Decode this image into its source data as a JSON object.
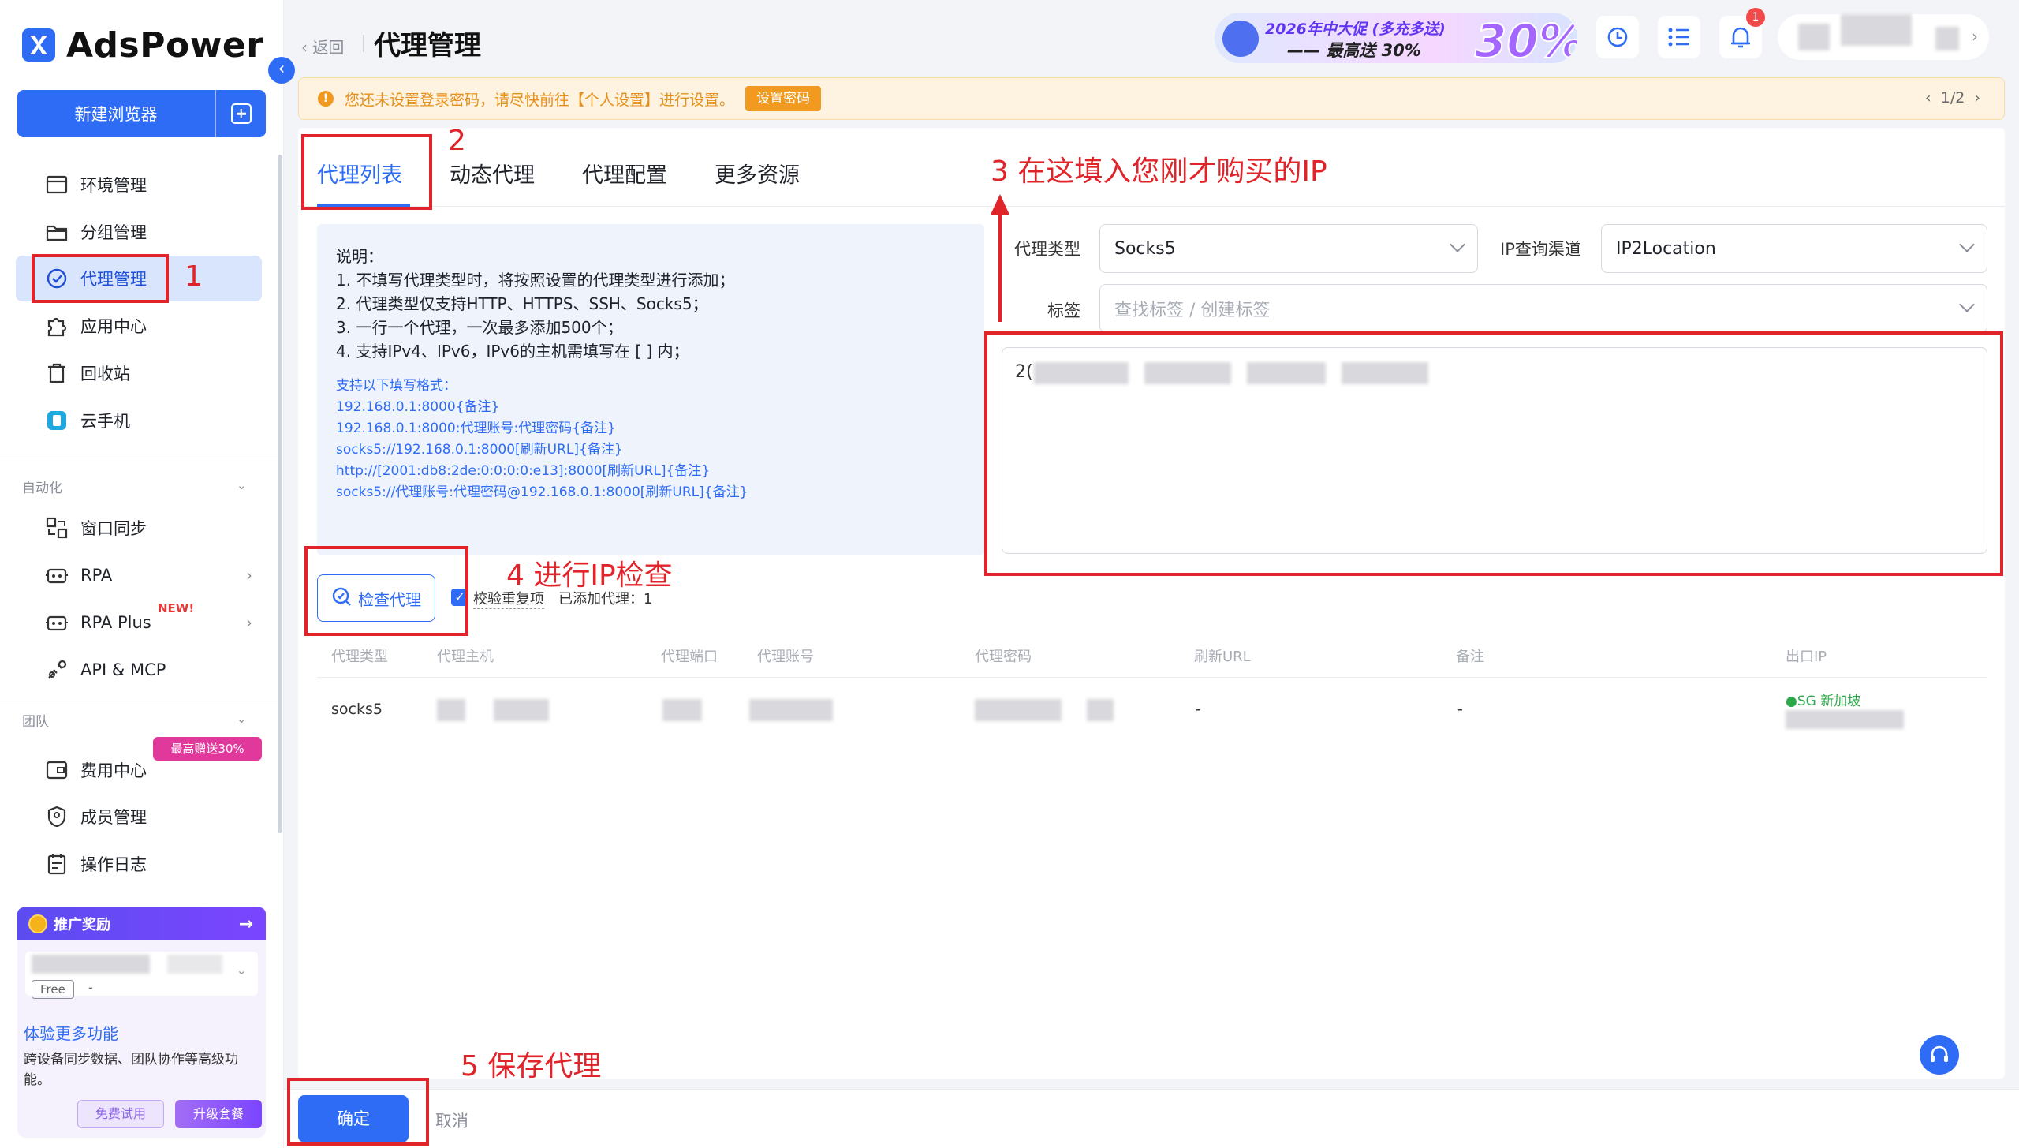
{
  "app": {
    "name": "AdsPower"
  },
  "sidebar": {
    "new_browser_label": "新建浏览器",
    "items": [
      {
        "label": "环境管理",
        "icon": "browser-window-icon"
      },
      {
        "label": "分组管理",
        "icon": "folder-icon"
      },
      {
        "label": "代理管理",
        "icon": "proxy-icon",
        "active": true
      },
      {
        "label": "应用中心",
        "icon": "puzzle-icon"
      },
      {
        "label": "回收站",
        "icon": "trash-icon"
      },
      {
        "label": "云手机",
        "icon": "cloud-phone-icon"
      }
    ],
    "section_automation": "自动化",
    "automation_items": [
      {
        "label": "窗口同步",
        "icon": "window-sync-icon"
      },
      {
        "label": "RPA",
        "icon": "robot-icon"
      },
      {
        "label": "RPA Plus",
        "icon": "robot-icon",
        "badge": "NEW!"
      },
      {
        "label": "API & MCP",
        "icon": "api-icon"
      }
    ],
    "section_team": "团队",
    "team_badge": "最高赠送30%",
    "team_items": [
      {
        "label": "费用中心",
        "icon": "wallet-icon"
      },
      {
        "label": "成员管理",
        "icon": "shield-user-icon"
      },
      {
        "label": "操作日志",
        "icon": "log-icon"
      }
    ],
    "promo": {
      "header": "推广奖励",
      "plan": "Free",
      "plan_suffix": "-",
      "title": "体验更多功能",
      "desc": "跨设备同步数据、团队协作等高级功能。",
      "trial_label": "免费试用",
      "upgrade_label": "升级套餐"
    }
  },
  "header": {
    "back_label": "返回",
    "title": "代理管理",
    "banner": {
      "line1": "2026年中大促 (多充多送)",
      "line2": "—— 最高送 30%",
      "big": "30%"
    },
    "notif_count": "1"
  },
  "alert": {
    "text": "您还未设置登录密码，请尽快前往【个人设置】进行设置。",
    "button": "设置密码",
    "pager": "1/2"
  },
  "tabs": [
    "代理列表",
    "动态代理",
    "代理配置",
    "更多资源"
  ],
  "info": {
    "lines": [
      "说明：",
      "1. 不填写代理类型时，将按照设置的代理类型进行添加；",
      "2. 代理类型仅支持HTTP、HTTPS、SSH、Socks5；",
      "3. 一行一个代理，一次最多添加500个；",
      "4. 支持IPv4、IPv6，IPv6的主机需填写在 [ ] 内；"
    ],
    "formats_title": "支持以下填写格式：",
    "formats": [
      "192.168.0.1:8000{备注}",
      "192.168.0.1:8000:代理账号:代理密码{备注}",
      "socks5://192.168.0.1:8000[刷新URL]{备注}",
      "http://[2001:db8:2de:0:0:0:0:e13]:8000[刷新URL]{备注}",
      "socks5://代理账号:代理密码@192.168.0.1:8000[刷新URL]{备注}"
    ]
  },
  "form": {
    "proxy_type_label": "代理类型",
    "proxy_type_value": "Socks5",
    "ip_channel_label": "IP查询渠道",
    "ip_channel_value": "IP2Location",
    "tag_label": "标签",
    "tag_placeholder": "查找标签 / 创建标签",
    "textarea_prefix": "2("
  },
  "actions": {
    "check_proxy_label": "检查代理",
    "dedupe_label": "校验重复项",
    "added_label": "已添加代理：1"
  },
  "table": {
    "headers": [
      "代理类型",
      "代理主机",
      "代理端口",
      "代理账号",
      "代理密码",
      "刷新URL",
      "备注",
      "出口IP"
    ],
    "row": {
      "type": "socks5",
      "refresh_url": "-",
      "remark": "-",
      "exit_ip_geo": "●SG 新加坡"
    }
  },
  "footer": {
    "ok_label": "确定",
    "cancel_label": "取消"
  },
  "annotations": {
    "n1": "1",
    "n2": "2",
    "n3": "3 在这填入您刚才购买的IP",
    "n4": "4 进行IP检查",
    "n5": "5 保存代理"
  },
  "colors": {
    "accent": "#2f6cf6",
    "annotation": "#e1242a",
    "warning": "#f29a1f"
  }
}
